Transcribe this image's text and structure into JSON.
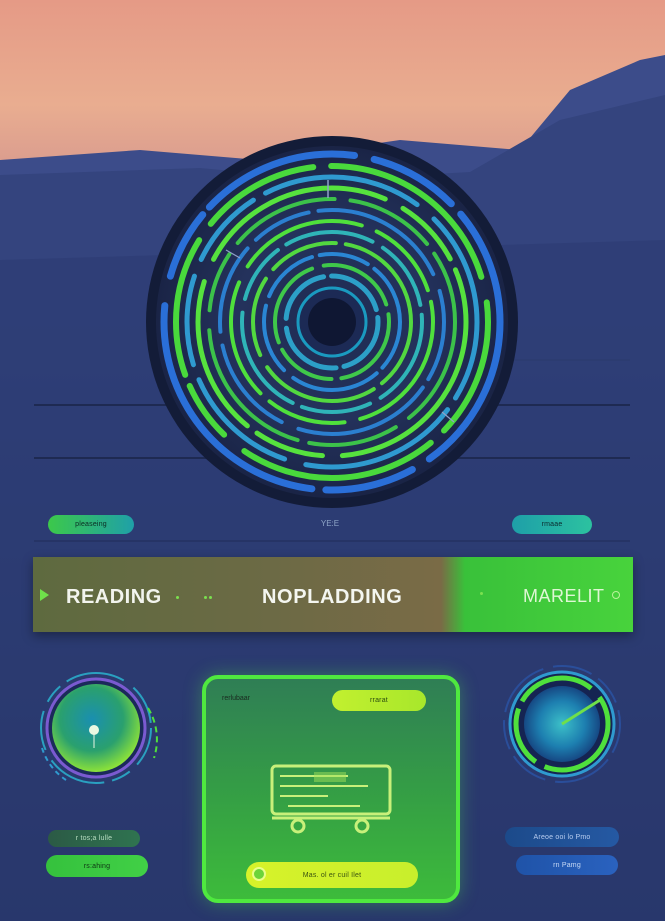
{
  "colors": {
    "accent_green": "#4fe93f",
    "accent_lime": "#c8ef2c",
    "accent_teal": "#1fa0a8",
    "accent_blue": "#2559a3",
    "background_navy": "#2a3a6e",
    "sky_peach": "#e8a98f"
  },
  "top_row": {
    "left_pill_label": "pleaseing",
    "center_label": "YE:E",
    "right_pill_label": "rmaae"
  },
  "status_bar": {
    "left_icon": "play-icon",
    "left_label": "READING",
    "center_label": "NOPLADDING",
    "right_label": "MARELIT"
  },
  "left_widget": {
    "icon": "gauge-dial-icon",
    "label": "r tos;a lulle",
    "action_label": "rs:ahing"
  },
  "center_card": {
    "tab_left": "rerlubaar",
    "tab_right": "rrarat",
    "icon": "monitor-cart-icon",
    "action_label": "Mas. ol er cuil Ilet"
  },
  "right_widget": {
    "icon": "radar-dial-icon",
    "label": "Areoe ooi lo Pmo",
    "action_label": "rn Pamg"
  },
  "hero": {
    "icon": "disc-vinyl-icon"
  }
}
